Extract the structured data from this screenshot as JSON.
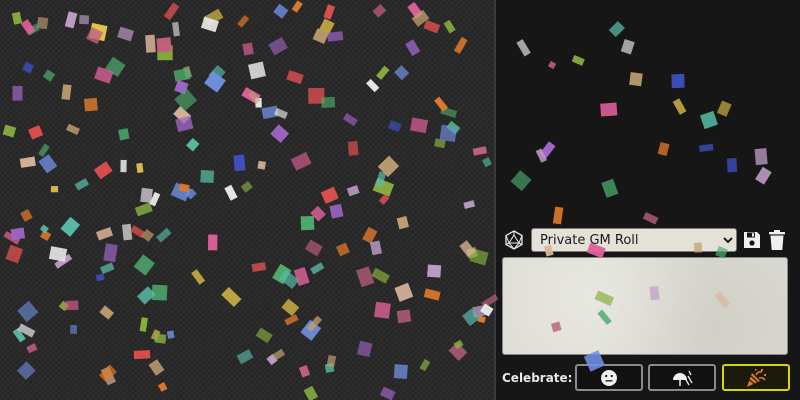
{
  "roll_mode": {
    "selected": "Private GM Roll",
    "options": [
      "Private GM Roll"
    ]
  },
  "chat_input": {
    "value": ""
  },
  "celebrate": {
    "label": "Celebrate:",
    "buttons": [
      "neutral-face-icon",
      "rain-icon",
      "party-popper-icon"
    ],
    "active": "party-popper-icon"
  },
  "icons": {
    "roll_mode": "d20-icon",
    "save": "floppy-disk-icon",
    "delete": "trash-icon"
  },
  "colors": {
    "background": "#2a2a2a",
    "sidebar": "#161616",
    "input": "#dcdbd2",
    "active_border": "#d6d600"
  }
}
